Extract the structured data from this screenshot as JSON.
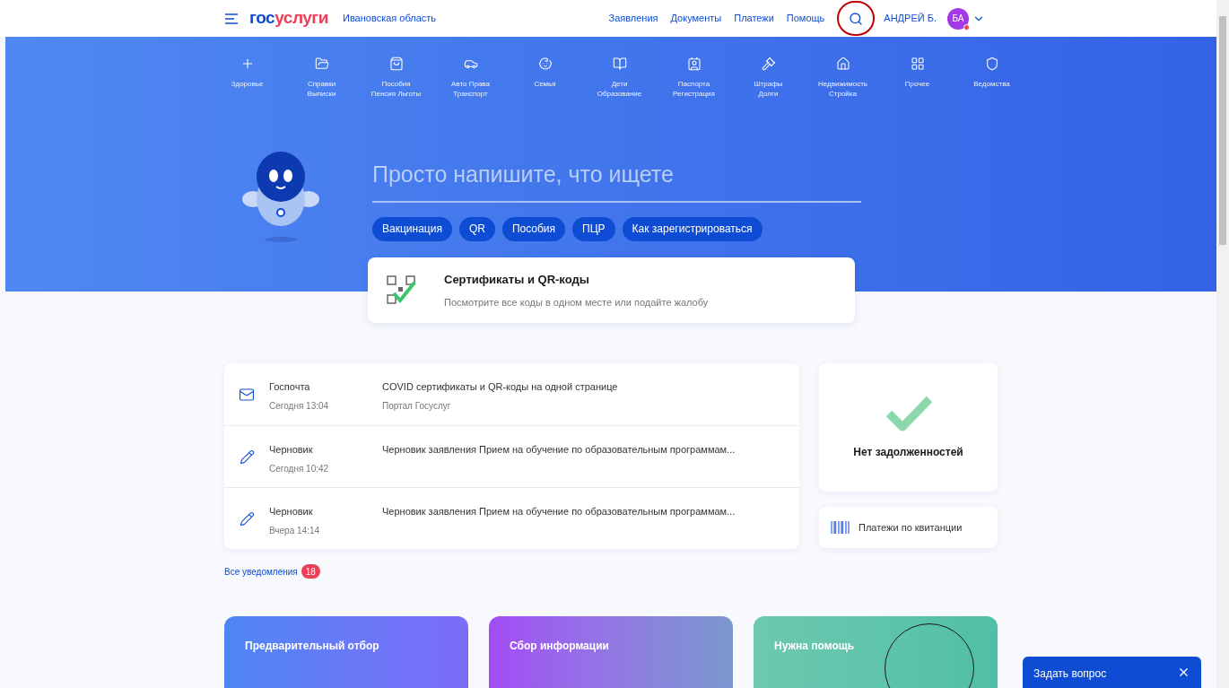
{
  "header": {
    "logo_parts": [
      "гос",
      "услуги"
    ],
    "region": "Ивановская область",
    "nav": [
      "Заявления",
      "Документы",
      "Платежи",
      "Помощь"
    ],
    "search_highlighted": true,
    "user": "АНДРЕЙ Б.",
    "avatar": "БА",
    "has_notification": true
  },
  "categories": [
    {
      "lines": [
        "Здоровье"
      ]
    },
    {
      "lines": [
        "Справки",
        "Выписки"
      ]
    },
    {
      "lines": [
        "Пособия",
        "Пенсия Льготы"
      ]
    },
    {
      "lines": [
        "Авто Права",
        "Транспорт"
      ]
    },
    {
      "lines": [
        "Семья"
      ]
    },
    {
      "lines": [
        "Дети",
        "Образование"
      ]
    },
    {
      "lines": [
        "Паспорта",
        "Регистрация"
      ]
    },
    {
      "lines": [
        "Штрафы",
        "Долги"
      ]
    },
    {
      "lines": [
        "Недвижимость",
        "Стройка"
      ]
    },
    {
      "lines": [
        "Прочее"
      ]
    },
    {
      "lines": [
        "Ведомства"
      ]
    }
  ],
  "search": {
    "placeholder": "Просто напишите, что ищете",
    "chips": [
      "Вакцинация",
      "QR",
      "Пособия",
      "ПЦР",
      "Как зарегистрироваться"
    ]
  },
  "promo": {
    "title": "Сертификаты и QR-коды",
    "subtitle": "Посмотрите все коды в одном месте или подайте жалобу"
  },
  "notifications": [
    {
      "kind": "mail",
      "source": "Госпочта",
      "time": "Сегодня 13:04",
      "title": "COVID сертификаты и QR-коды на одной странице",
      "detail": "Портал Госуслуг"
    },
    {
      "kind": "draft",
      "source": "Черновик",
      "time": "Сегодня 10:42",
      "title": "Черновик заявления Прием на обучение по образовательным программам..."
    },
    {
      "kind": "draft",
      "source": "Черновик",
      "time": "Вчера 14:14",
      "title": "Черновик заявления Прием на обучение по образовательным программам..."
    }
  ],
  "all_notifications": {
    "label": "Все уведомления",
    "count": "18"
  },
  "debts": {
    "label": "Нет задолженностей"
  },
  "receipt_payments": "Платежи по квитанции",
  "banners": [
    {
      "title": "Предварительный отбор"
    },
    {
      "title": "Сбор информации"
    },
    {
      "title": "Нужна помощь"
    }
  ],
  "chat": {
    "label": "Задать вопрос"
  }
}
